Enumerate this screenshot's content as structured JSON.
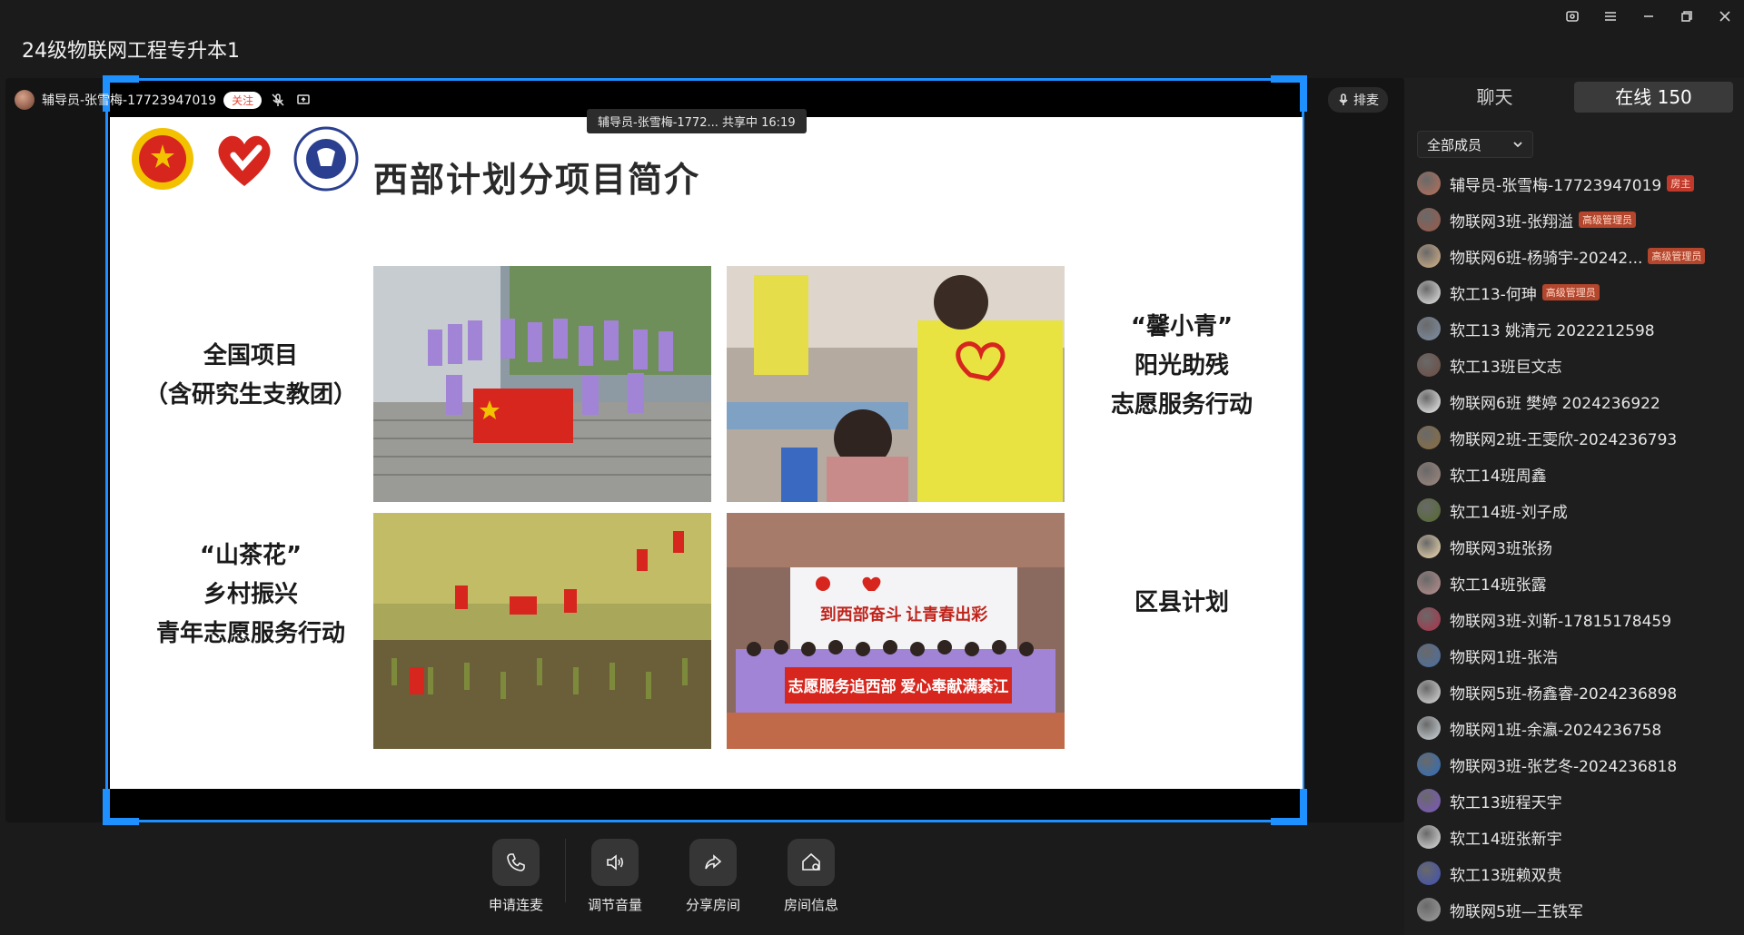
{
  "window": {
    "title": "24级物联网工程专升本1",
    "controls": [
      "record-icon",
      "menu-icon",
      "minimize-icon",
      "restore-icon",
      "close-icon"
    ]
  },
  "presenter": {
    "name": "辅导员-张雪梅-17723947019",
    "follow_label": "关注"
  },
  "share_tip": "辅导员-张雪梅-1772... 共享中 16:19",
  "mic_queue_label": "排麦",
  "slide": {
    "title": "西部计划分项目简介",
    "label_1_line1": "全国项目",
    "label_1_line2": "（含研究生支教团）",
    "label_2_line1": "“馨小青”",
    "label_2_line2": "阳光助残",
    "label_2_line3": "志愿服务行动",
    "label_3_line1": "“山茶花”",
    "label_3_line2": "乡村振兴",
    "label_3_line3": "青年志愿服务行动",
    "label_4": "区县计划",
    "banner_top": "到西部奋斗 让青春出彩",
    "banner_bottom": "志愿服务追西部 爱心奉献满綦江"
  },
  "actions": [
    {
      "label": "申请连麦",
      "icon": "phone-icon"
    },
    {
      "label": "调节音量",
      "icon": "volume-icon"
    },
    {
      "label": "分享房间",
      "icon": "share-icon"
    },
    {
      "label": "房间信息",
      "icon": "room-info-icon"
    }
  ],
  "panel": {
    "tab_chat": "聊天",
    "tab_online": "在线 150",
    "filter_label": "全部成员",
    "members": [
      {
        "name": "辅导员-张雪梅-17723947019",
        "badge": "房主",
        "color": "#b9705a"
      },
      {
        "name": "物联网3班-张翔溢",
        "badge": "高级管理员",
        "color": "#9c5a4a"
      },
      {
        "name": "物联网6班-杨骑宇-20242...",
        "badge": "高级管理员",
        "color": "#d9b48a"
      },
      {
        "name": "软工13-何珅",
        "badge": "高级管理员",
        "color": "#e8e8e8"
      },
      {
        "name": "软工13 姚清元 2022212598",
        "badge": "",
        "color": "#7f8fa6"
      },
      {
        "name": "软工13班巨文志",
        "badge": "",
        "color": "#6d4c41"
      },
      {
        "name": "物联网6班 樊婷 2024236922",
        "badge": "",
        "color": "#f2f2f2"
      },
      {
        "name": "物联网2班-王雯欣-2024236793",
        "badge": "",
        "color": "#8d6e3f"
      },
      {
        "name": "软工14班周鑫",
        "badge": "",
        "color": "#a1887f"
      },
      {
        "name": "软工14班-刘子成",
        "badge": "",
        "color": "#556b2f"
      },
      {
        "name": "物联网3班张扬",
        "badge": "",
        "color": "#f5deb3"
      },
      {
        "name": "软工14班张露",
        "badge": "",
        "color": "#bc8f8f"
      },
      {
        "name": "物联网3班-刘靳-17815178459",
        "badge": "",
        "color": "#b0304a"
      },
      {
        "name": "物联网1班-张浩",
        "badge": "",
        "color": "#4a6fa5"
      },
      {
        "name": "物联网5班-杨鑫睿-2024236898",
        "badge": "",
        "color": "#dddddd"
      },
      {
        "name": "物联网1班-余瀛-2024236758",
        "badge": "",
        "color": "#cfd8dc"
      },
      {
        "name": "物联网3班-张艺冬-2024236818",
        "badge": "",
        "color": "#2e6fbf"
      },
      {
        "name": "软工13班程天宇",
        "badge": "",
        "color": "#7e57c2"
      },
      {
        "name": "软工14班张新宇",
        "badge": "",
        "color": "#e0e0e0"
      },
      {
        "name": "软工13班赖双贵",
        "badge": "",
        "color": "#3f51b5"
      },
      {
        "name": "物联网5班—王铁军",
        "badge": "",
        "color": "#9e9e9e"
      }
    ]
  }
}
